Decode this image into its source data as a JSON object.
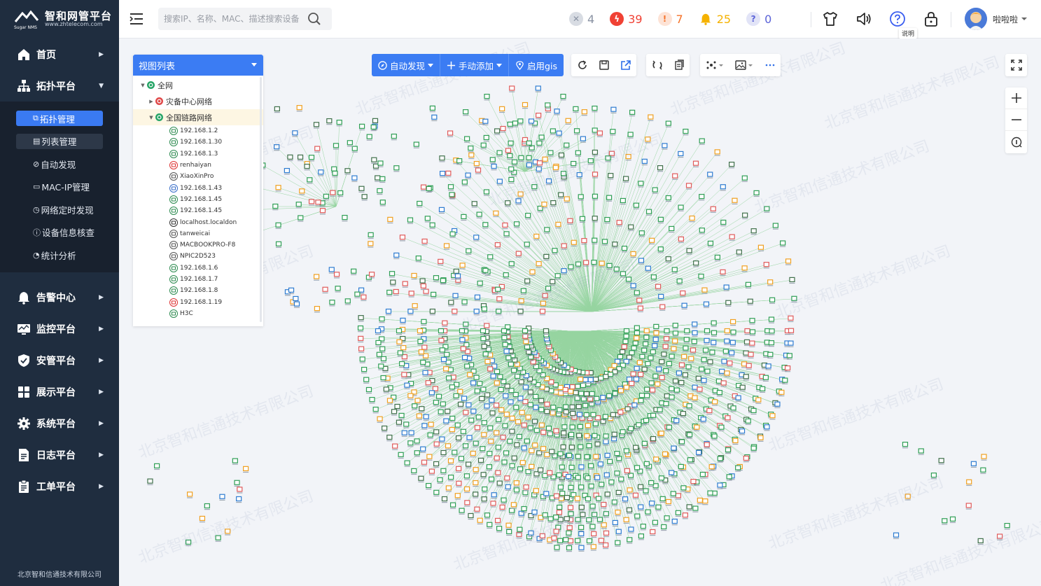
{
  "brand": {
    "title": "智和网管平台",
    "subtitle": "www.zhtelecom.com",
    "logo_text": "Sugar NMS",
    "company": "北京智和信通技术有限公司"
  },
  "sidebar": {
    "items": [
      {
        "label": "首页",
        "icon": "home-icon"
      },
      {
        "label": "拓扑平台",
        "icon": "topology-icon",
        "expanded": true
      },
      {
        "label": "告警中心",
        "icon": "bell-icon"
      },
      {
        "label": "监控平台",
        "icon": "monitor-icon"
      },
      {
        "label": "安管平台",
        "icon": "shield-icon"
      },
      {
        "label": "展示平台",
        "icon": "grid-icon"
      },
      {
        "label": "系统平台",
        "icon": "gear-icon"
      },
      {
        "label": "日志平台",
        "icon": "document-icon"
      },
      {
        "label": "工单平台",
        "icon": "clipboard-icon"
      }
    ],
    "submenu": [
      {
        "label": "拓扑管理",
        "icon": "topology-small-icon",
        "state": "active"
      },
      {
        "label": "列表管理",
        "icon": "list-icon",
        "state": "hover"
      },
      {
        "label": "自动发现",
        "icon": "compass-icon"
      },
      {
        "label": "MAC-IP管理",
        "icon": "chat-icon"
      },
      {
        "label": "网络定时发现",
        "icon": "clock-icon"
      },
      {
        "label": "设备信息核查",
        "icon": "info-icon"
      },
      {
        "label": "统计分析",
        "icon": "pie-icon"
      }
    ]
  },
  "topbar": {
    "search_placeholder": "搜索IP、名称、MAC、描述搜索设备",
    "stats": [
      {
        "icon": "close-circle-icon",
        "value": "4",
        "color": "#8a93a3"
      },
      {
        "icon": "lightning-icon",
        "value": "39",
        "color": "#f04134"
      },
      {
        "icon": "exclamation-icon",
        "value": "7",
        "color": "#f5732b"
      },
      {
        "icon": "bell-alert-icon",
        "value": "25",
        "color": "#f5b200"
      },
      {
        "icon": "question-icon",
        "value": "0",
        "color": "#5b63d8"
      }
    ],
    "help_tooltip": "说明",
    "user_name": "啦啦啦"
  },
  "view_panel": {
    "title": "视图列表",
    "tree": [
      {
        "label": "全网",
        "color": "#27a567",
        "caret": "▼"
      },
      {
        "label": "灾备中心网络",
        "color": "#e04a4a",
        "caret": "▶"
      },
      {
        "label": "全国链路网络",
        "color": "#27a567",
        "caret": "▼"
      }
    ],
    "leaves": [
      "192.168.1.2",
      "192.168.1.30",
      "192.168.1.3",
      "renhaiyan",
      "XiaoXinPro",
      "192.168.1.43",
      "192.168.1.45",
      "192.168.1.45",
      "localhost.localdon",
      "tanweicai",
      "MACBOOKPRO-F8",
      "NPIC2D523",
      "192.168.1.6",
      "192.168.1.7",
      "192.168.1.8",
      "192.168.1.19",
      "H3C"
    ]
  },
  "toolbar": {
    "auto_discover": "自动发现",
    "manual_add": "手动添加",
    "enable_gis": "启用gis"
  },
  "watermark_text": "北京智和信通技术有限公司",
  "colors": {
    "sidebar_bg": "#1f2d3f",
    "accent": "#3b7cf3",
    "link_green": "#4cbb5a"
  }
}
